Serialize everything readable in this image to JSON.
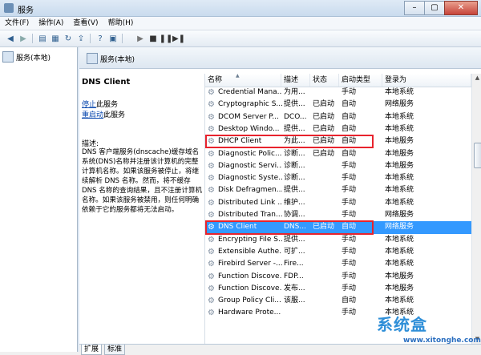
{
  "window": {
    "title": "服务"
  },
  "menu": [
    "文件(F)",
    "操作(A)",
    "查看(V)",
    "帮助(H)"
  ],
  "toolbar_icons": [
    "back-icon",
    "forward-icon",
    "console-tree-icon",
    "properties-icon",
    "refresh-icon",
    "export-icon",
    "help-icon",
    "console-icon",
    "play-icon",
    "stop-icon",
    "pause-icon",
    "restart-icon"
  ],
  "tree": {
    "root_label": "服务(本地)"
  },
  "right_header": {
    "title": "服务(本地)"
  },
  "details": {
    "service_name": "DNS Client",
    "stop_link_prefix": "停止",
    "stop_link_suffix": "此服务",
    "restart_link_prefix": "重启动",
    "restart_link_suffix": "此服务",
    "desc_label": "描述:",
    "desc_text": "DNS 客户端服务(dnscache)缓存域名系统(DNS)名称并注册该计算机的完整计算机名称。如果该服务被停止，将继续解析 DNS 名称。然而，将不缓存 DNS 名称的查询结果，且不注册计算机名称。如果该服务被禁用，则任何明确依赖于它的服务都将无法启动。"
  },
  "columns": [
    "名称",
    "描述",
    "状态",
    "启动类型",
    "登录为"
  ],
  "rows": [
    {
      "name": "Credential Mana...",
      "desc": "为用...",
      "status": "",
      "startup": "手动",
      "logon": "本地系统"
    },
    {
      "name": "Cryptographic S...",
      "desc": "提供...",
      "status": "已启动",
      "startup": "自动",
      "logon": "网络服务"
    },
    {
      "name": "DCOM Server P...",
      "desc": "DCO...",
      "status": "已启动",
      "startup": "自动",
      "logon": "本地系统"
    },
    {
      "name": "Desktop Windo...",
      "desc": "提供...",
      "status": "已启动",
      "startup": "自动",
      "logon": "本地系统"
    },
    {
      "name": "DHCP Client",
      "desc": "为此...",
      "status": "已启动",
      "startup": "自动",
      "logon": "本地服务"
    },
    {
      "name": "Diagnostic Polic...",
      "desc": "诊断...",
      "status": "已启动",
      "startup": "自动",
      "logon": "本地服务"
    },
    {
      "name": "Diagnostic Servi...",
      "desc": "诊断...",
      "status": "",
      "startup": "手动",
      "logon": "本地服务"
    },
    {
      "name": "Diagnostic Syste...",
      "desc": "诊断...",
      "status": "",
      "startup": "手动",
      "logon": "本地系统"
    },
    {
      "name": "Disk Defragmen...",
      "desc": "提供...",
      "status": "",
      "startup": "手动",
      "logon": "本地系统"
    },
    {
      "name": "Distributed Link ...",
      "desc": "维护...",
      "status": "",
      "startup": "手动",
      "logon": "本地系统"
    },
    {
      "name": "Distributed Tran...",
      "desc": "协调...",
      "status": "",
      "startup": "手动",
      "logon": "网络服务"
    },
    {
      "name": "DNS Client",
      "desc": "DNS...",
      "status": "已启动",
      "startup": "自动",
      "logon": "网络服务"
    },
    {
      "name": "Encrypting File S...",
      "desc": "提供...",
      "status": "",
      "startup": "手动",
      "logon": "本地系统"
    },
    {
      "name": "Extensible Authe...",
      "desc": "可扩...",
      "status": "",
      "startup": "手动",
      "logon": "本地系统"
    },
    {
      "name": "Firebird Server -...",
      "desc": "Fire...",
      "status": "",
      "startup": "手动",
      "logon": "本地系统"
    },
    {
      "name": "Function Discove...",
      "desc": "FDP...",
      "status": "",
      "startup": "手动",
      "logon": "本地服务"
    },
    {
      "name": "Function Discove...",
      "desc": "发布...",
      "status": "",
      "startup": "手动",
      "logon": "本地服务"
    },
    {
      "name": "Group Policy Cli...",
      "desc": "该服...",
      "status": "",
      "startup": "自动",
      "logon": "本地系统"
    },
    {
      "name": "Hardware Prote...",
      "desc": "",
      "status": "",
      "startup": "手动",
      "logon": "本地系统"
    }
  ],
  "selected_row_index": 11,
  "highlighted_row_indices": [
    4,
    11
  ],
  "tabs": [
    "扩展",
    "标准"
  ],
  "watermark": {
    "logo": "系统盒",
    "url": "www.xitonghe.com"
  },
  "colors": {
    "selection": "#3399ff",
    "highlight_box": "#e8232d",
    "link": "#0645ad"
  }
}
